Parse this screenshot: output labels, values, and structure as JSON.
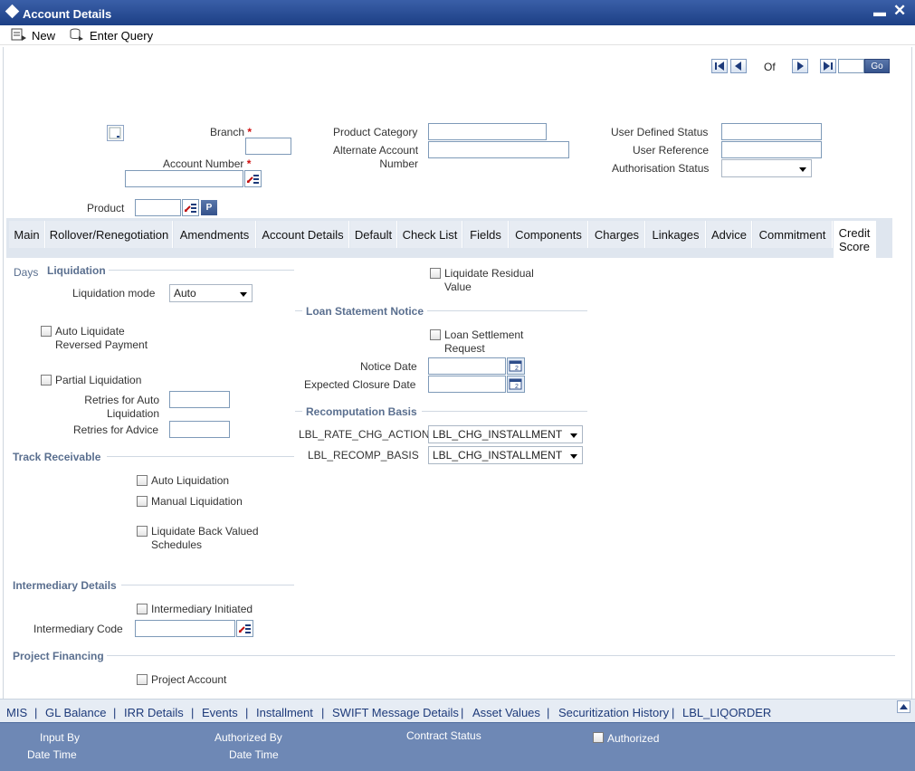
{
  "window": {
    "title": "Account Details"
  },
  "toolbar": {
    "new_label": "New",
    "enter_query_label": "Enter Query"
  },
  "pager": {
    "of_label": "Of",
    "go_label": "Go"
  },
  "header": {
    "branch_label": "Branch",
    "account_number_label": "Account Number",
    "product_label": "Product",
    "product_btn": "P",
    "product_category_label": "Product Category",
    "alternate_account_label_1": "Alternate Account",
    "alternate_account_label_2": "Number",
    "user_defined_status_label": "User Defined Status",
    "user_reference_label": "User Reference",
    "authorisation_status_label": "Authorisation Status",
    "required_mark": "*"
  },
  "tabs": [
    {
      "label": "Main"
    },
    {
      "label": "Rollover/Renegotiation"
    },
    {
      "label": "Amendments"
    },
    {
      "label": "Account Details"
    },
    {
      "label": "Default"
    },
    {
      "label": "Check List"
    },
    {
      "label": "Fields"
    },
    {
      "label": "Components"
    },
    {
      "label": "Charges"
    },
    {
      "label": "Linkages"
    },
    {
      "label": "Advice"
    },
    {
      "label": "Commitment"
    },
    {
      "label": "Credit Score",
      "line1": "Credit",
      "line2": "Score"
    }
  ],
  "liquidation": {
    "days_label": "Days",
    "section_title": "Liquidation",
    "mode_label": "Liquidation mode",
    "mode_value": "Auto",
    "auto_liq_reversed_1": "Auto Liquidate",
    "auto_liq_reversed_2": "Reversed Payment",
    "partial_liquidation": "Partial Liquidation",
    "retries_auto_1": "Retries for Auto",
    "retries_auto_2": "Liquidation",
    "retries_advice": "Retries for Advice"
  },
  "track_receivable": {
    "section_title": "Track Receivable",
    "auto_liquidation": "Auto Liquidation",
    "manual_liquidation": "Manual Liquidation",
    "back_valued_1": "Liquidate Back Valued",
    "back_valued_2": "Schedules"
  },
  "intermediary": {
    "section_title": "Intermediary Details",
    "initiated": "Intermediary Initiated",
    "code_label": "Intermediary Code"
  },
  "project_financing": {
    "section_title": "Project Financing",
    "project_account": "Project Account"
  },
  "right": {
    "residual_1": "Liquidate Residual",
    "residual_2": "Value",
    "loan_statement_title": "Loan Statement Notice",
    "settlement_1": "Loan Settlement",
    "settlement_2": "Request",
    "notice_date": "Notice Date",
    "expected_closure": "Expected Closure Date",
    "recomp_title": "Recomputation Basis",
    "rate_chg_label": "LBL_RATE_CHG_ACTION",
    "rate_chg_value": "LBL_CHG_INSTALLMENT",
    "recomp_basis_label": "LBL_RECOMP_BASIS",
    "recomp_basis_value": "LBL_CHG_INSTALLMENT"
  },
  "bottom_links": [
    "MIS",
    "GL Balance",
    "IRR Details",
    "Events",
    "Installment",
    "SWIFT Message Details",
    "Asset Values",
    "Securitization History",
    "LBL_LIQORDER"
  ],
  "bottom_sep": "|",
  "footer": {
    "input_by": "Input By",
    "date_time": "Date Time",
    "authorized_by": "Authorized By",
    "date_time_2": "Date Time",
    "contract_status": "Contract Status",
    "authorized": "Authorized"
  },
  "colors": {
    "titlebar": "#2a4d96",
    "footer": "#6e88b5",
    "section": "#5a6f8f",
    "link": "#1d3a7a"
  }
}
